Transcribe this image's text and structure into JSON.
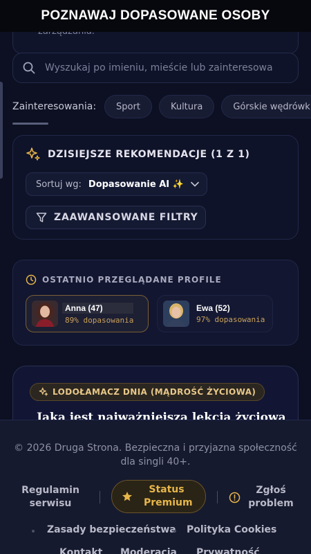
{
  "header": {
    "title": "POZNAWAJ DOPASOWANE OSOBY"
  },
  "previous_card": {
    "text": "zarządzania."
  },
  "search": {
    "placeholder": "Wyszukaj po imieniu, mieście lub zainteresowar"
  },
  "interests": {
    "label": "Zainteresowania:",
    "chips": [
      "Sport",
      "Kultura",
      "Górskie wędrówki"
    ]
  },
  "recommendations": {
    "title": "DZISIEJSZE REKOMENDACJE (1 Z 1)",
    "sort_label": "Sortuj wg:",
    "sort_value": "Dopasowanie AI ✨",
    "filters_button": "ZAAWANSOWANE FILTRY"
  },
  "recent": {
    "title": "OSTATNIO PRZEGLĄDANE PROFILE",
    "profiles": [
      {
        "name": "Anna (47)",
        "match": "89% dopasowania"
      },
      {
        "name": "Ewa (52)",
        "match": "97% dopasowania"
      }
    ]
  },
  "icebreaker": {
    "badge": "LODOŁAMACZ DNIA (MĄDROŚĆ ŻYCIOWA)",
    "question": "Jaka jest najważniejsza lekcja życiowa"
  },
  "footer": {
    "copyright": "© 2026 Druga Strona. Bezpieczna i przyjazna społeczność dla singli 40+.",
    "terms": "Regulamin serwisu",
    "premium": "Status Premium",
    "report": "Zgłoś problem",
    "safety": "Zasady bezpieczeństwa",
    "cookies": "Polityka Cookies",
    "contact": "Kontakt",
    "moderation": "Moderacja",
    "privacy": "Prywatność"
  },
  "colors": {
    "accent_gold": "#e7b64a",
    "background": "#0c1022"
  },
  "icons": [
    "search-icon",
    "sparkle-icon",
    "chevron-down-icon",
    "filter-icon",
    "clock-icon",
    "star-icon",
    "alert-icon"
  ]
}
